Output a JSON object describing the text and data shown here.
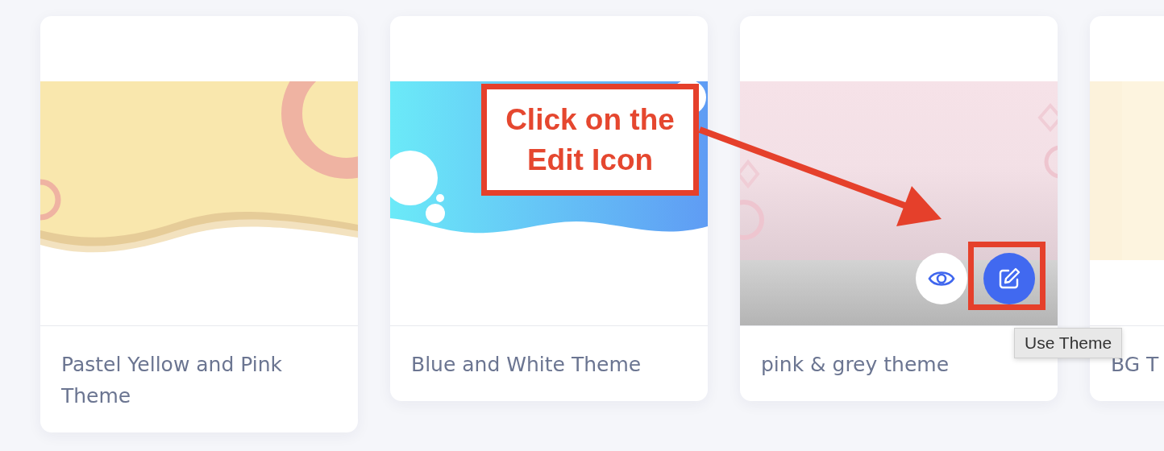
{
  "cards": [
    {
      "title": "Pastel Yellow and Pink Theme",
      "kind": "wave",
      "hovered": false
    },
    {
      "title": "Blue and White Theme",
      "kind": "bubbles",
      "hovered": false
    },
    {
      "title": "pink & grey theme",
      "kind": "gradient",
      "hovered": true
    },
    {
      "title": "BG T",
      "kind": "plain",
      "hovered": false
    }
  ],
  "tooltip": "Use Theme",
  "annotation": {
    "callout": "Click on the Edit Icon"
  }
}
